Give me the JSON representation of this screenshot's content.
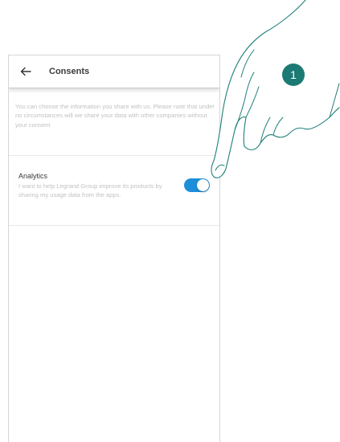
{
  "header": {
    "title": "Consents",
    "back_icon": "arrow-left-icon"
  },
  "intro_text": "You can choose the information you share with us. Please note that under no circumstances will we share your data with other companies without your consent",
  "consents": [
    {
      "title": "Analytics",
      "description": "I want to help Legrand Group improve its products by sharing my usage data from the apps.",
      "enabled": true
    }
  ],
  "callout": {
    "step_number": "1"
  },
  "colors": {
    "toggle_on": "#1d8ed9",
    "step_badge": "#1c7a74"
  }
}
